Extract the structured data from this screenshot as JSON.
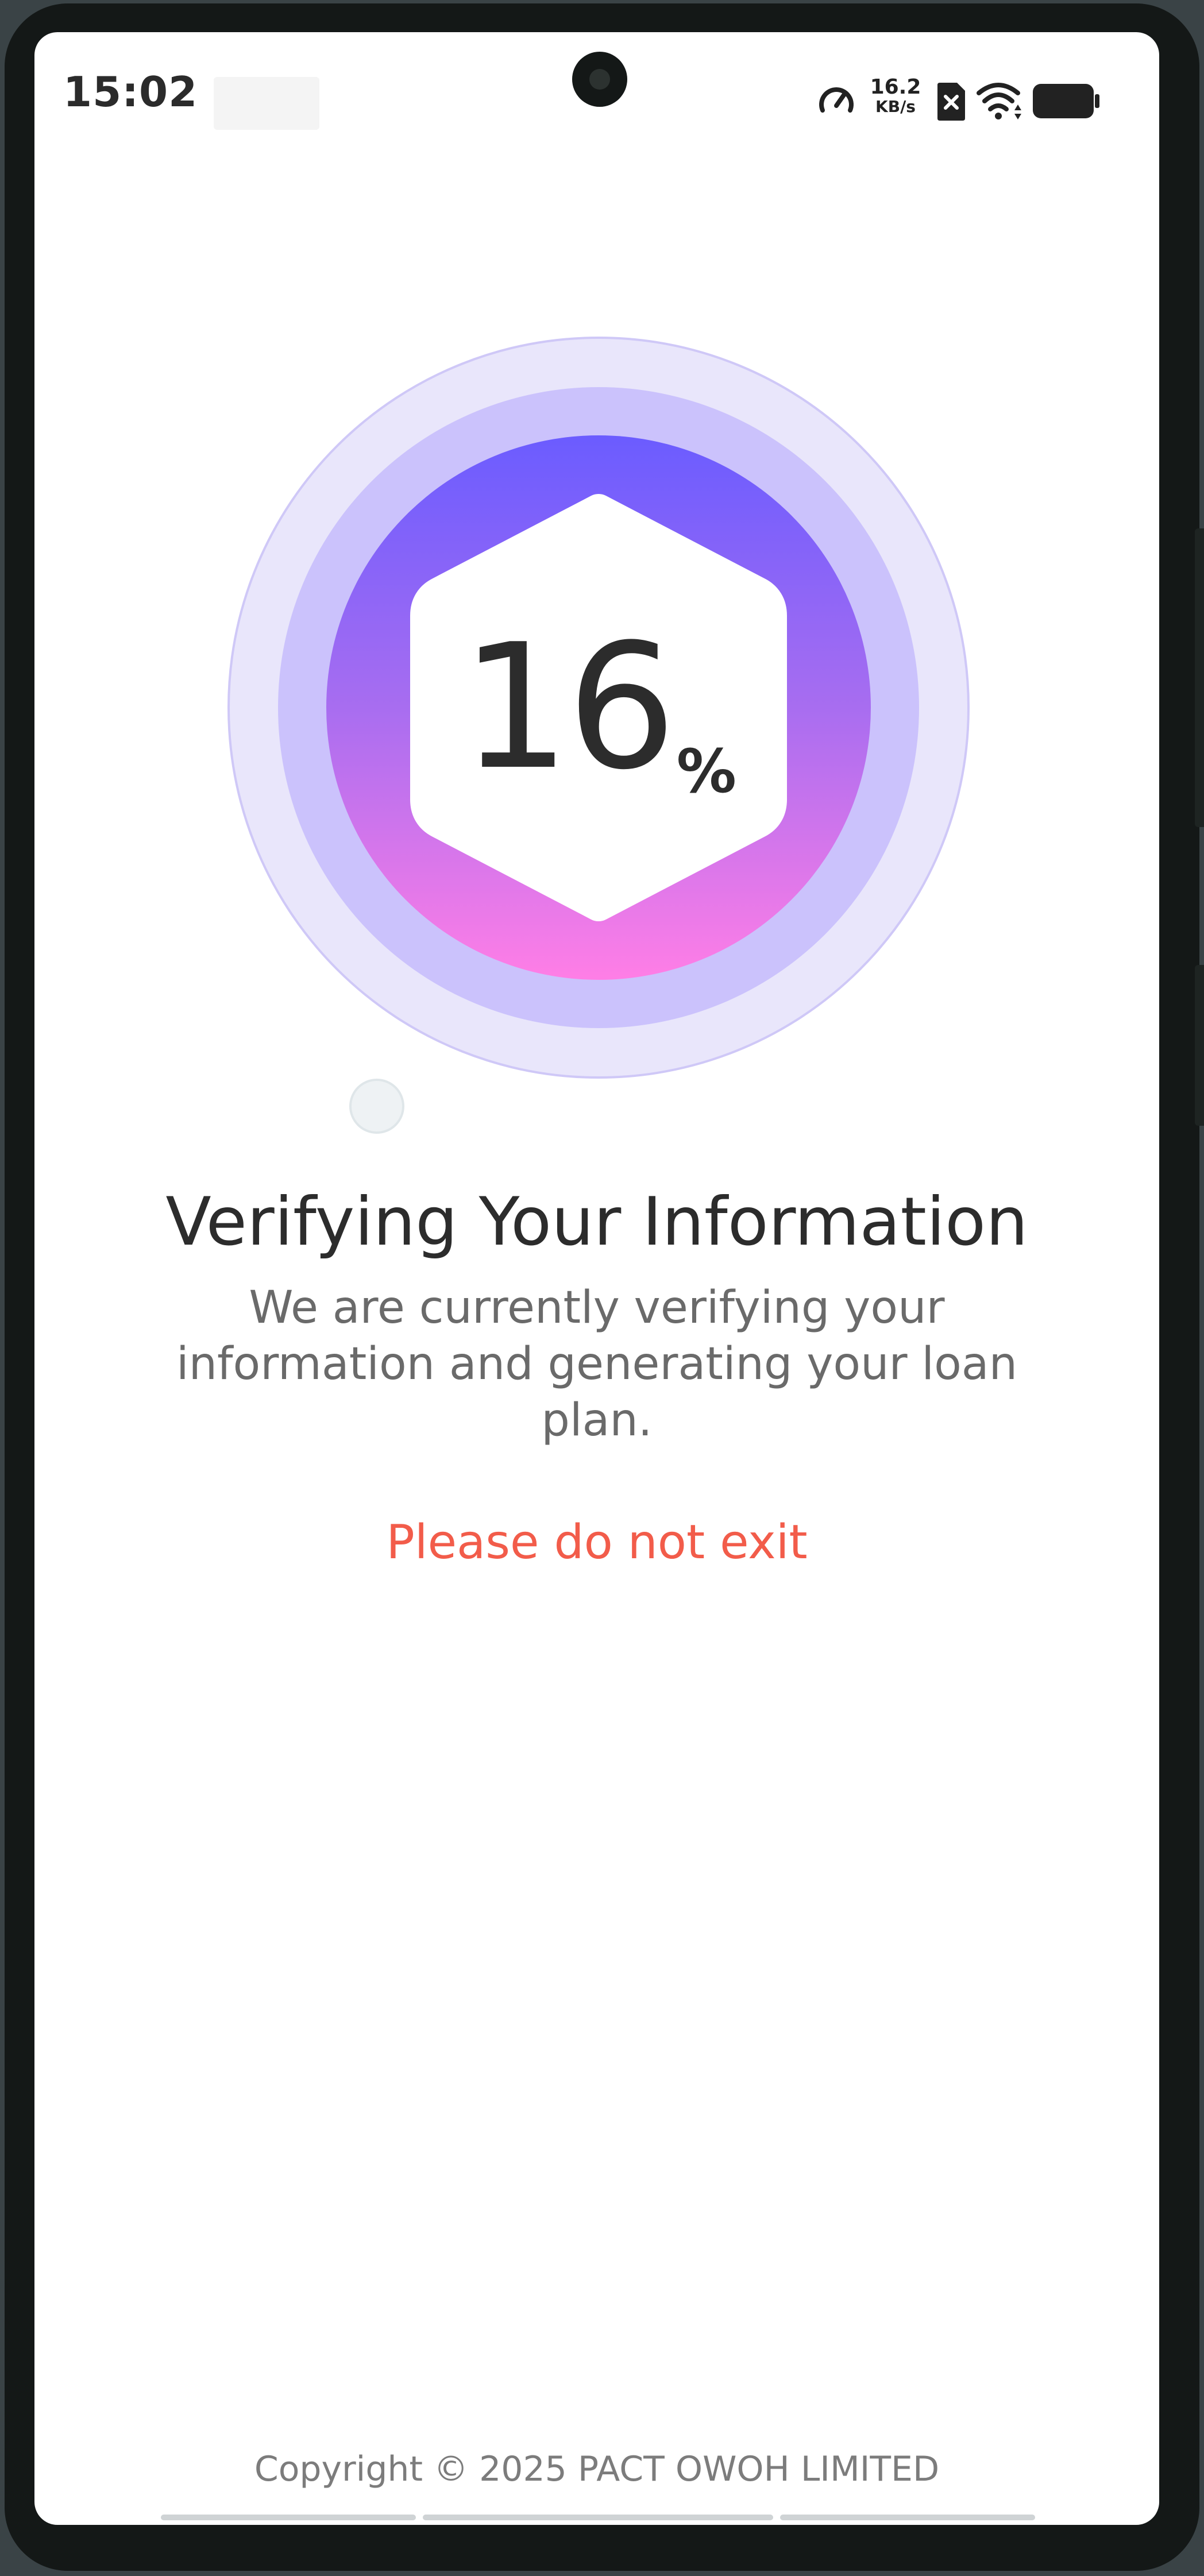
{
  "status_bar": {
    "time": "15:02",
    "net_rate_value": "16.2",
    "net_rate_unit": "KB/s",
    "icons": [
      "speed-gauge-icon",
      "sim-blocked-icon",
      "wifi-icon",
      "battery-icon"
    ]
  },
  "progress": {
    "value": "16",
    "unit": "%",
    "fraction": 0.16
  },
  "content": {
    "title": "Verifying Your Information",
    "description": "We are currently verifying your information and generating your loan plan.",
    "warning": "Please do not exit"
  },
  "footer": {
    "copyright": "Copyright © 2025 PACT OWOH LIMITED"
  },
  "colors": {
    "gradient_top": "#6b5cff",
    "gradient_mid": "#a86df0",
    "gradient_bottom": "#ff7ee6",
    "outer_ring": "#e9e6fb",
    "middle_ring": "#cbc2fc",
    "warning": "#f25c4a",
    "title": "#2c2c2c"
  }
}
